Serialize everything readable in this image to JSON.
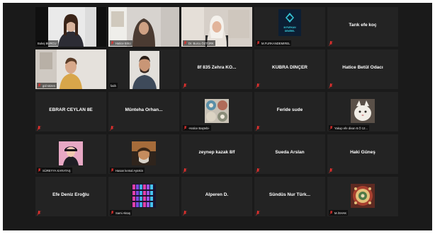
{
  "tiles": [
    {
      "label": "Bukej BURCU"
    },
    {
      "label": "Hatice Bilici"
    },
    {
      "label": "Dr. Burcu ÖZTÜRK"
    },
    {
      "label": "M.FURKANDEMIREL",
      "logo_line1": "M.FURKAN",
      "logo_line2": "DEMİREL"
    },
    {
      "name": "Tarık efe koç"
    },
    {
      "label": "gül sözen"
    },
    {
      "label": "fatih"
    },
    {
      "name": "8f 835 Zehra KO..."
    },
    {
      "name": "KÜBRA DİNÇER"
    },
    {
      "name": "Hatice Betül Odacı"
    },
    {
      "name": "EBRAR CEYLAN 8E"
    },
    {
      "name": "Münteha  Orhan..."
    },
    {
      "label": "-Hatice Baştebi-"
    },
    {
      "name": "Feride sude"
    },
    {
      "label": "Yakup efe divan 8.Ö 12..."
    },
    {
      "label": "SÜREYYA KARATAŞ"
    },
    {
      "label": "Hasan kemal Aytekin"
    },
    {
      "name": "zeynep kazak 8/f"
    },
    {
      "name": "Sueda Arslan"
    },
    {
      "name": "Haki Güneş"
    },
    {
      "name": "Efe Deniz Eroğlu"
    },
    {
      "label": "Sami Aktaş"
    },
    {
      "name": "Alperen D."
    },
    {
      "name": "Sündüs  Nur  Türk..."
    },
    {
      "label": "M.İSHAK"
    }
  ],
  "colors": {
    "background": "#1a1a1a",
    "tile": "#232323",
    "active_speaker": "#c9de4a",
    "muted_mic": "#e0302e"
  }
}
